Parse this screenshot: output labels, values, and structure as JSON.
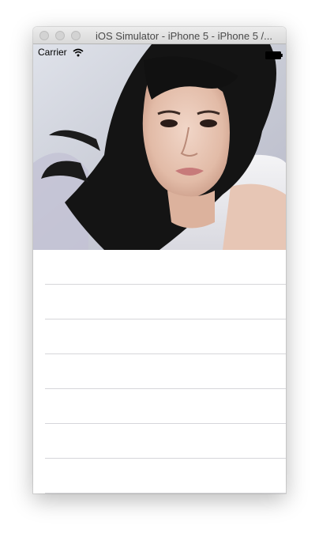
{
  "window": {
    "title": "iOS Simulator - iPhone 5 - iPhone 5 /..."
  },
  "status_bar": {
    "carrier": "Carrier",
    "wifi_icon": "wifi-icon",
    "battery_icon": "battery-icon"
  },
  "header_image": {
    "description_icon": "portrait-photo"
  },
  "table": {
    "rows": [
      {
        "label": ""
      },
      {
        "label": ""
      },
      {
        "label": ""
      },
      {
        "label": ""
      },
      {
        "label": ""
      },
      {
        "label": ""
      },
      {
        "label": ""
      }
    ]
  },
  "colors": {
    "separator": "#d6d6da",
    "titlebar_text": "#4a4a4a"
  }
}
